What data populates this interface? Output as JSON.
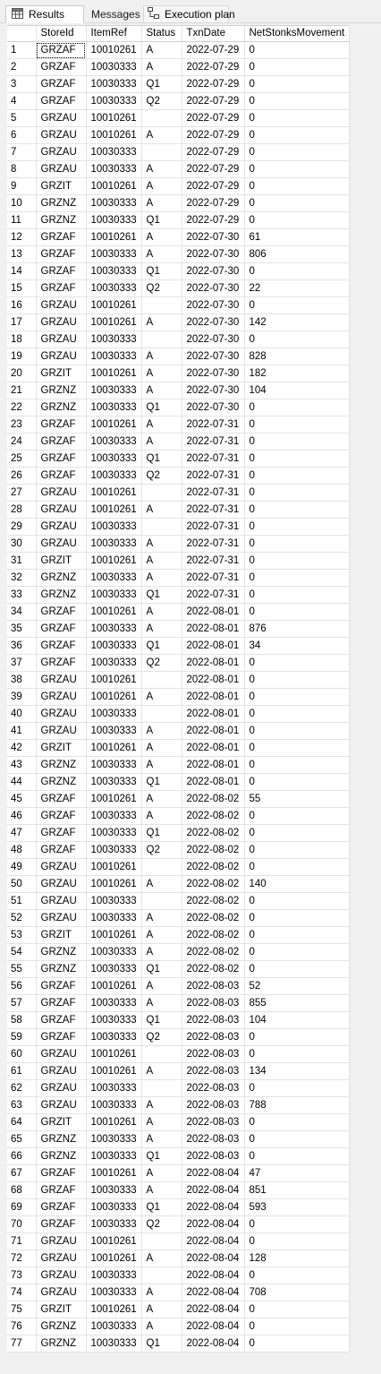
{
  "tabs": {
    "results": {
      "label": "Results",
      "icon": "grid-icon"
    },
    "messages": {
      "label": "Messages"
    },
    "execution_plan": {
      "label": "Execution plan",
      "icon": "execution-plan-icon"
    }
  },
  "grid": {
    "columns": [
      "StoreId",
      "ItemRef",
      "Status",
      "TxnDate",
      "NetStonksMovement"
    ],
    "rows": [
      [
        "1",
        "GRZAF",
        "10010261",
        "A",
        "2022-07-29",
        "0"
      ],
      [
        "2",
        "GRZAF",
        "10030333",
        "A",
        "2022-07-29",
        "0"
      ],
      [
        "3",
        "GRZAF",
        "10030333",
        "Q1",
        "2022-07-29",
        "0"
      ],
      [
        "4",
        "GRZAF",
        "10030333",
        "Q2",
        "2022-07-29",
        "0"
      ],
      [
        "5",
        "GRZAU",
        "10010261",
        "",
        "2022-07-29",
        "0"
      ],
      [
        "6",
        "GRZAU",
        "10010261",
        "A",
        "2022-07-29",
        "0"
      ],
      [
        "7",
        "GRZAU",
        "10030333",
        "",
        "2022-07-29",
        "0"
      ],
      [
        "8",
        "GRZAU",
        "10030333",
        "A",
        "2022-07-29",
        "0"
      ],
      [
        "9",
        "GRZIT",
        "10010261",
        "A",
        "2022-07-29",
        "0"
      ],
      [
        "10",
        "GRZNZ",
        "10030333",
        "A",
        "2022-07-29",
        "0"
      ],
      [
        "11",
        "GRZNZ",
        "10030333",
        "Q1",
        "2022-07-29",
        "0"
      ],
      [
        "12",
        "GRZAF",
        "10010261",
        "A",
        "2022-07-30",
        "61"
      ],
      [
        "13",
        "GRZAF",
        "10030333",
        "A",
        "2022-07-30",
        "806"
      ],
      [
        "14",
        "GRZAF",
        "10030333",
        "Q1",
        "2022-07-30",
        "0"
      ],
      [
        "15",
        "GRZAF",
        "10030333",
        "Q2",
        "2022-07-30",
        "22"
      ],
      [
        "16",
        "GRZAU",
        "10010261",
        "",
        "2022-07-30",
        "0"
      ],
      [
        "17",
        "GRZAU",
        "10010261",
        "A",
        "2022-07-30",
        "142"
      ],
      [
        "18",
        "GRZAU",
        "10030333",
        "",
        "2022-07-30",
        "0"
      ],
      [
        "19",
        "GRZAU",
        "10030333",
        "A",
        "2022-07-30",
        "828"
      ],
      [
        "20",
        "GRZIT",
        "10010261",
        "A",
        "2022-07-30",
        "182"
      ],
      [
        "21",
        "GRZNZ",
        "10030333",
        "A",
        "2022-07-30",
        "104"
      ],
      [
        "22",
        "GRZNZ",
        "10030333",
        "Q1",
        "2022-07-30",
        "0"
      ],
      [
        "23",
        "GRZAF",
        "10010261",
        "A",
        "2022-07-31",
        "0"
      ],
      [
        "24",
        "GRZAF",
        "10030333",
        "A",
        "2022-07-31",
        "0"
      ],
      [
        "25",
        "GRZAF",
        "10030333",
        "Q1",
        "2022-07-31",
        "0"
      ],
      [
        "26",
        "GRZAF",
        "10030333",
        "Q2",
        "2022-07-31",
        "0"
      ],
      [
        "27",
        "GRZAU",
        "10010261",
        "",
        "2022-07-31",
        "0"
      ],
      [
        "28",
        "GRZAU",
        "10010261",
        "A",
        "2022-07-31",
        "0"
      ],
      [
        "29",
        "GRZAU",
        "10030333",
        "",
        "2022-07-31",
        "0"
      ],
      [
        "30",
        "GRZAU",
        "10030333",
        "A",
        "2022-07-31",
        "0"
      ],
      [
        "31",
        "GRZIT",
        "10010261",
        "A",
        "2022-07-31",
        "0"
      ],
      [
        "32",
        "GRZNZ",
        "10030333",
        "A",
        "2022-07-31",
        "0"
      ],
      [
        "33",
        "GRZNZ",
        "10030333",
        "Q1",
        "2022-07-31",
        "0"
      ],
      [
        "34",
        "GRZAF",
        "10010261",
        "A",
        "2022-08-01",
        "0"
      ],
      [
        "35",
        "GRZAF",
        "10030333",
        "A",
        "2022-08-01",
        "876"
      ],
      [
        "36",
        "GRZAF",
        "10030333",
        "Q1",
        "2022-08-01",
        "34"
      ],
      [
        "37",
        "GRZAF",
        "10030333",
        "Q2",
        "2022-08-01",
        "0"
      ],
      [
        "38",
        "GRZAU",
        "10010261",
        "",
        "2022-08-01",
        "0"
      ],
      [
        "39",
        "GRZAU",
        "10010261",
        "A",
        "2022-08-01",
        "0"
      ],
      [
        "40",
        "GRZAU",
        "10030333",
        "",
        "2022-08-01",
        "0"
      ],
      [
        "41",
        "GRZAU",
        "10030333",
        "A",
        "2022-08-01",
        "0"
      ],
      [
        "42",
        "GRZIT",
        "10010261",
        "A",
        "2022-08-01",
        "0"
      ],
      [
        "43",
        "GRZNZ",
        "10030333",
        "A",
        "2022-08-01",
        "0"
      ],
      [
        "44",
        "GRZNZ",
        "10030333",
        "Q1",
        "2022-08-01",
        "0"
      ],
      [
        "45",
        "GRZAF",
        "10010261",
        "A",
        "2022-08-02",
        "55"
      ],
      [
        "46",
        "GRZAF",
        "10030333",
        "A",
        "2022-08-02",
        "0"
      ],
      [
        "47",
        "GRZAF",
        "10030333",
        "Q1",
        "2022-08-02",
        "0"
      ],
      [
        "48",
        "GRZAF",
        "10030333",
        "Q2",
        "2022-08-02",
        "0"
      ],
      [
        "49",
        "GRZAU",
        "10010261",
        "",
        "2022-08-02",
        "0"
      ],
      [
        "50",
        "GRZAU",
        "10010261",
        "A",
        "2022-08-02",
        "140"
      ],
      [
        "51",
        "GRZAU",
        "10030333",
        "",
        "2022-08-02",
        "0"
      ],
      [
        "52",
        "GRZAU",
        "10030333",
        "A",
        "2022-08-02",
        "0"
      ],
      [
        "53",
        "GRZIT",
        "10010261",
        "A",
        "2022-08-02",
        "0"
      ],
      [
        "54",
        "GRZNZ",
        "10030333",
        "A",
        "2022-08-02",
        "0"
      ],
      [
        "55",
        "GRZNZ",
        "10030333",
        "Q1",
        "2022-08-02",
        "0"
      ],
      [
        "56",
        "GRZAF",
        "10010261",
        "A",
        "2022-08-03",
        "52"
      ],
      [
        "57",
        "GRZAF",
        "10030333",
        "A",
        "2022-08-03",
        "855"
      ],
      [
        "58",
        "GRZAF",
        "10030333",
        "Q1",
        "2022-08-03",
        "104"
      ],
      [
        "59",
        "GRZAF",
        "10030333",
        "Q2",
        "2022-08-03",
        "0"
      ],
      [
        "60",
        "GRZAU",
        "10010261",
        "",
        "2022-08-03",
        "0"
      ],
      [
        "61",
        "GRZAU",
        "10010261",
        "A",
        "2022-08-03",
        "134"
      ],
      [
        "62",
        "GRZAU",
        "10030333",
        "",
        "2022-08-03",
        "0"
      ],
      [
        "63",
        "GRZAU",
        "10030333",
        "A",
        "2022-08-03",
        "788"
      ],
      [
        "64",
        "GRZIT",
        "10010261",
        "A",
        "2022-08-03",
        "0"
      ],
      [
        "65",
        "GRZNZ",
        "10030333",
        "A",
        "2022-08-03",
        "0"
      ],
      [
        "66",
        "GRZNZ",
        "10030333",
        "Q1",
        "2022-08-03",
        "0"
      ],
      [
        "67",
        "GRZAF",
        "10010261",
        "A",
        "2022-08-04",
        "47"
      ],
      [
        "68",
        "GRZAF",
        "10030333",
        "A",
        "2022-08-04",
        "851"
      ],
      [
        "69",
        "GRZAF",
        "10030333",
        "Q1",
        "2022-08-04",
        "593"
      ],
      [
        "70",
        "GRZAF",
        "10030333",
        "Q2",
        "2022-08-04",
        "0"
      ],
      [
        "71",
        "GRZAU",
        "10010261",
        "",
        "2022-08-04",
        "0"
      ],
      [
        "72",
        "GRZAU",
        "10010261",
        "A",
        "2022-08-04",
        "128"
      ],
      [
        "73",
        "GRZAU",
        "10030333",
        "",
        "2022-08-04",
        "0"
      ],
      [
        "74",
        "GRZAU",
        "10030333",
        "A",
        "2022-08-04",
        "708"
      ],
      [
        "75",
        "GRZIT",
        "10010261",
        "A",
        "2022-08-04",
        "0"
      ],
      [
        "76",
        "GRZNZ",
        "10030333",
        "A",
        "2022-08-04",
        "0"
      ],
      [
        "77",
        "GRZNZ",
        "10030333",
        "Q1",
        "2022-08-04",
        "0"
      ]
    ]
  },
  "colors": {
    "background": "#f0f0f0",
    "grid_background": "#ffffff",
    "grid_lines": "#e3e3e3"
  }
}
